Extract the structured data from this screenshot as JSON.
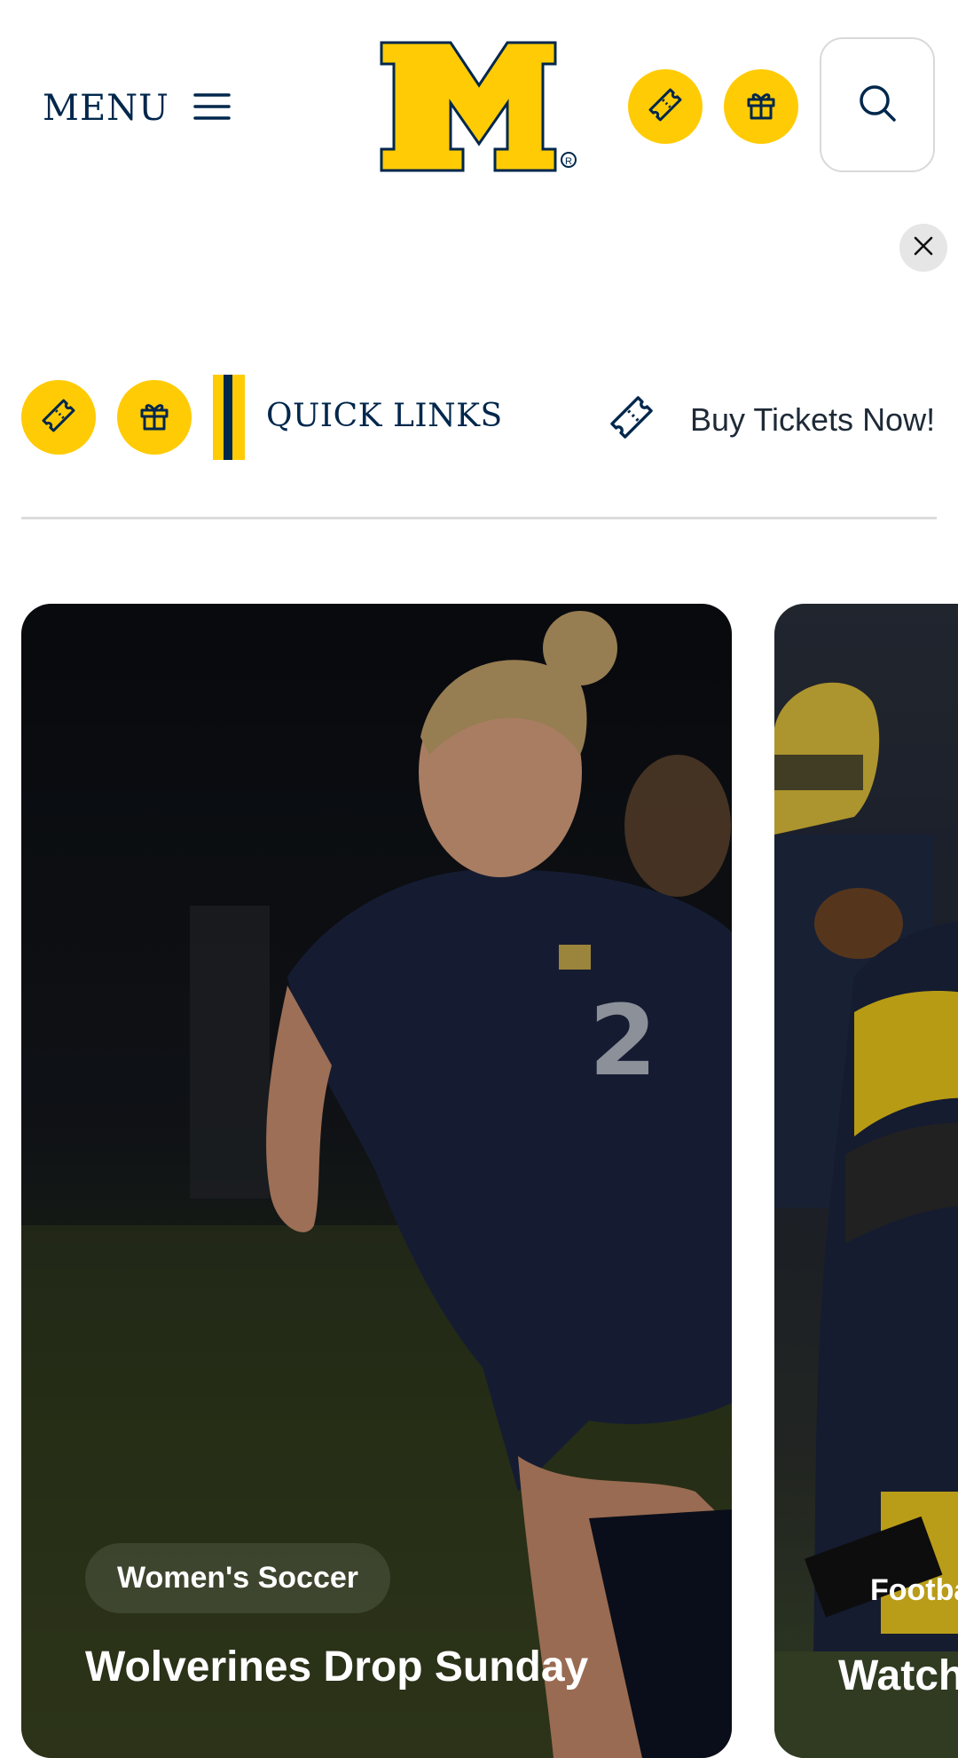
{
  "header": {
    "menu_label": "MENU",
    "logo_alt": "M"
  },
  "quick_links": {
    "title": "QUICK LINKS",
    "buy_tickets": "Buy Tickets Now!"
  },
  "cards": [
    {
      "category": "Women's Soccer",
      "headline": "Wolverines Drop Sunday",
      "jersey_number": "2"
    },
    {
      "category": "Footba",
      "headline": "Watch:"
    }
  ],
  "colors": {
    "maize": "#ffcb05",
    "blue": "#00274c"
  },
  "icons": [
    "hamburger-icon",
    "ticket-icon",
    "gift-icon",
    "search-icon",
    "close-icon"
  ]
}
